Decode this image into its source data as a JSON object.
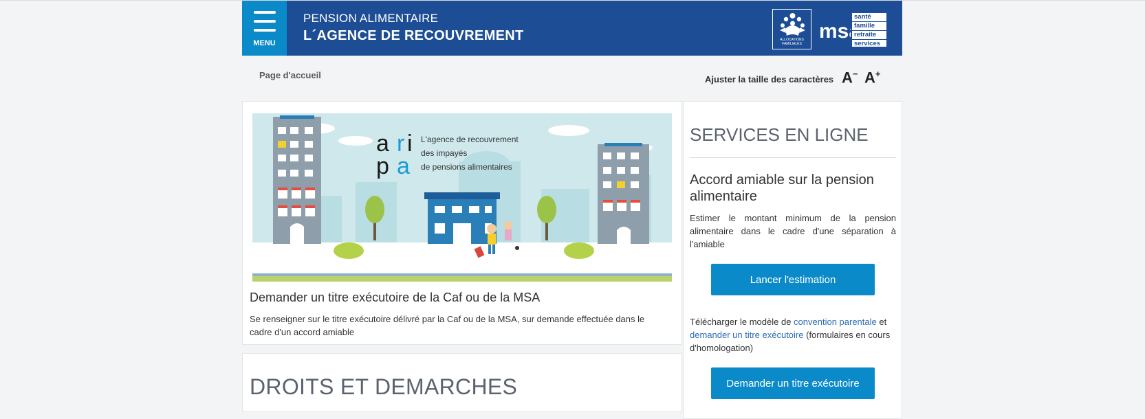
{
  "header": {
    "menu_label": "MENU",
    "title_line1": "PENSION ALIMENTAIRE",
    "title_line2": "L´AGENCE DE RECOUVREMENT",
    "caf_text": "ALLOCATIONS FAMILIALES",
    "msa_text": "msa",
    "msa_tags": [
      "santé",
      "famille",
      "retraite",
      "services"
    ]
  },
  "breadcrumb": "Page d'accueil",
  "font_adjust": {
    "label": "Ajuster la taille des caractères",
    "decrease": "A",
    "increase": "A"
  },
  "main_card": {
    "banner": {
      "letters": [
        "a",
        "r",
        "i",
        "p",
        "a"
      ],
      "tagline": [
        "L'agence de recouvrement",
        "des impayés",
        "de pensions alimentaires"
      ]
    },
    "title": "Demander un titre exécutoire de la Caf ou de la MSA",
    "description": "Se renseigner sur le titre exécutoire délivré par la Caf ou de la MSA, sur demande effectuée dans le cadre d'un accord amiable"
  },
  "droits_card": {
    "title": "DROITS ET DEMARCHES"
  },
  "services": {
    "title": "SERVICES EN LIGNE",
    "accord_title": "Accord amiable sur la pension alimentaire",
    "accord_desc": "Estimer le montant minimum de la pension alimentaire dans le cadre d'une séparation à l'amiable",
    "estimate_button": "Lancer l'estimation",
    "download_prefix": "Télécharger le modèle de",
    "link_convention": "convention parentale",
    "download_and": "et",
    "link_titre": "demander un titre exécutoire",
    "download_suffix": "(formulaires en cours d'homologation)",
    "titre_button": "Demander un titre exécutoire"
  },
  "colors": {
    "header_bg": "#1d4e95",
    "menu_bg": "#0b8ac9",
    "button_bg": "#0b8ac9",
    "link": "#2e6cb5",
    "page_bg": "#f3f4f5"
  }
}
